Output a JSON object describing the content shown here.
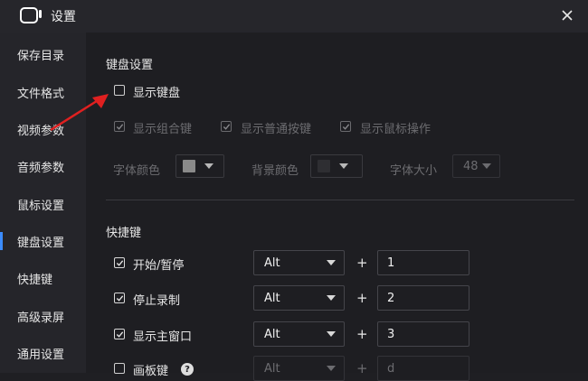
{
  "window": {
    "title": "设置",
    "close_icon": "close-icon",
    "app_icon": "camera-icon"
  },
  "sidebar": {
    "items": [
      {
        "label": "保存目录",
        "active": false
      },
      {
        "label": "文件格式",
        "active": false
      },
      {
        "label": "视频参数",
        "active": false
      },
      {
        "label": "音频参数",
        "active": false
      },
      {
        "label": "鼠标设置",
        "active": false
      },
      {
        "label": "键盘设置",
        "active": true
      },
      {
        "label": "快捷键",
        "active": false
      },
      {
        "label": "高级录屏",
        "active": false
      },
      {
        "label": "通用设置",
        "active": false
      }
    ]
  },
  "keyboard": {
    "section_title": "键盘设置",
    "show_keyboard": {
      "label": "显示键盘",
      "checked": false
    },
    "sub_options": [
      {
        "label": "显示组合键",
        "checked": true
      },
      {
        "label": "显示普通按键",
        "checked": true
      },
      {
        "label": "显示鼠标操作",
        "checked": true
      }
    ],
    "font_color_label": "字体颜色",
    "font_color": "#8a8a8a",
    "bg_color_label": "背景颜色",
    "bg_color": "#2e2e32",
    "font_size_label": "字体大小",
    "font_size_value": "48"
  },
  "hotkeys": {
    "section_title": "快捷键",
    "plus_sign": "+",
    "rows": [
      {
        "label": "开始/暂停",
        "checked": true,
        "modifier": "Alt",
        "key": "1"
      },
      {
        "label": "停止录制",
        "checked": true,
        "modifier": "Alt",
        "key": "2"
      },
      {
        "label": "显示主窗口",
        "checked": true,
        "modifier": "Alt",
        "key": "3"
      },
      {
        "label": "画板键",
        "checked": false,
        "modifier": "Alt",
        "key": "d"
      }
    ],
    "help_icon": "help-icon",
    "help_glyph": "?"
  },
  "colors": {
    "accent": "#3b8cff",
    "annotation_arrow": "#e02020"
  }
}
